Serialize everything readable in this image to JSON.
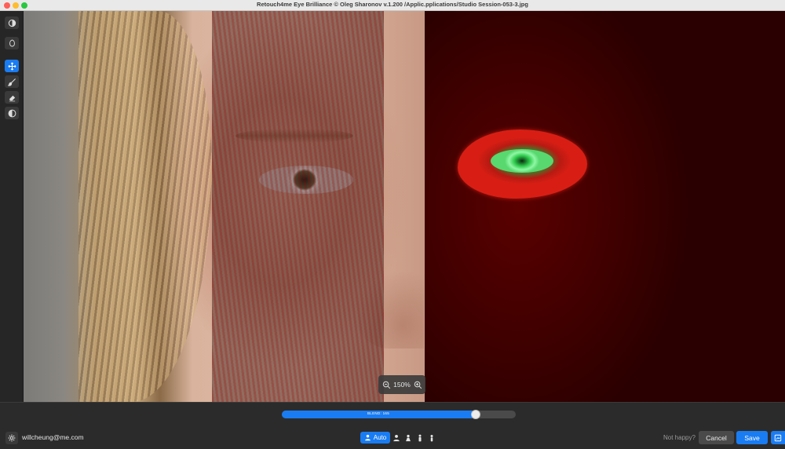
{
  "window": {
    "title": "Retouch4me Eye Brilliance © Oleg Sharonov v.1.200 /Applic.pplications/Studio Session-053-3.jpg"
  },
  "toolbar": {
    "tools": [
      {
        "name": "compare-icon",
        "active": false
      },
      {
        "name": "mask-icon",
        "active": false
      },
      {
        "name": "move-icon",
        "active": true
      },
      {
        "name": "brush-icon",
        "active": false
      },
      {
        "name": "eraser-icon",
        "active": false
      },
      {
        "name": "contrast-icon",
        "active": false
      }
    ]
  },
  "zoom": {
    "label": "150%"
  },
  "blend": {
    "label": "BLEND: 165",
    "fraction": 0.83
  },
  "footer": {
    "email": "willcheung@me.com",
    "auto_label": "Auto",
    "not_happy": "Not happy?",
    "cancel_label": "Cancel",
    "save_label": "Save"
  },
  "colors": {
    "accent": "#1a7cf2",
    "mask_red": "#d81e14",
    "mask_green": "#2ecb4c"
  }
}
